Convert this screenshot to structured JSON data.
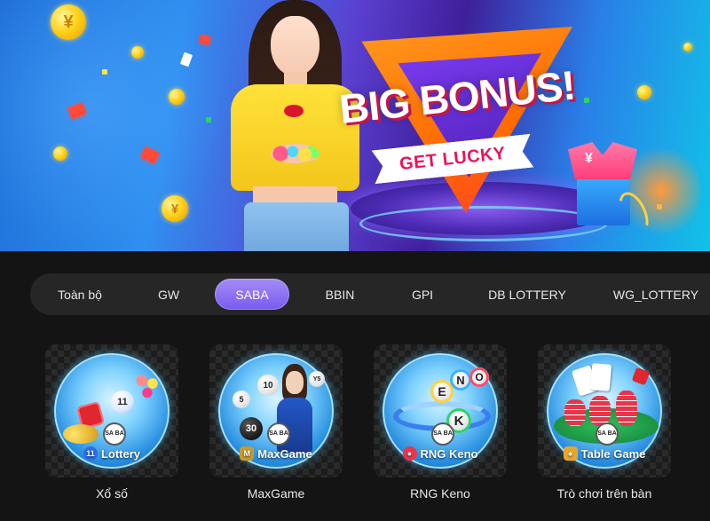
{
  "banner": {
    "title": "BIG BONUS!",
    "ribbon": "GET LUCKY",
    "coin_symbol": "¥",
    "gift_symbol": "¥",
    "colors": {
      "accent": "#ff6a00",
      "ribbon_text": "#e8155b",
      "background": "#141414"
    }
  },
  "tabs": [
    {
      "label": "Toàn bộ",
      "active": false
    },
    {
      "label": "GW",
      "active": false
    },
    {
      "label": "SABA",
      "active": true
    },
    {
      "label": "BBIN",
      "active": false
    },
    {
      "label": "GPI",
      "active": false
    },
    {
      "label": "DB LOTTERY",
      "active": false
    },
    {
      "label": "WG_LOTTERY",
      "active": false
    }
  ],
  "games": [
    {
      "badge": "SA BA",
      "brand": "Lottery",
      "brand_icon": "lottery-icon",
      "label": "Xổ số"
    },
    {
      "badge": "SA BA",
      "brand": "MaxGame",
      "brand_icon": "maxgame-icon",
      "label": "MaxGame"
    },
    {
      "badge": "SA BA",
      "brand": "RNG Keno",
      "brand_icon": "keno-icon",
      "label": "RNG Keno"
    },
    {
      "badge": "SA BA",
      "brand": "Table Game",
      "brand_icon": "table-game-icon",
      "label": "Trò chơi trên bàn"
    }
  ],
  "balls": {
    "lottery": [
      "11"
    ],
    "maxgame": [
      "10",
      "5",
      "30",
      "Y5"
    ],
    "keno": [
      "E",
      "N",
      "O",
      "K"
    ]
  }
}
